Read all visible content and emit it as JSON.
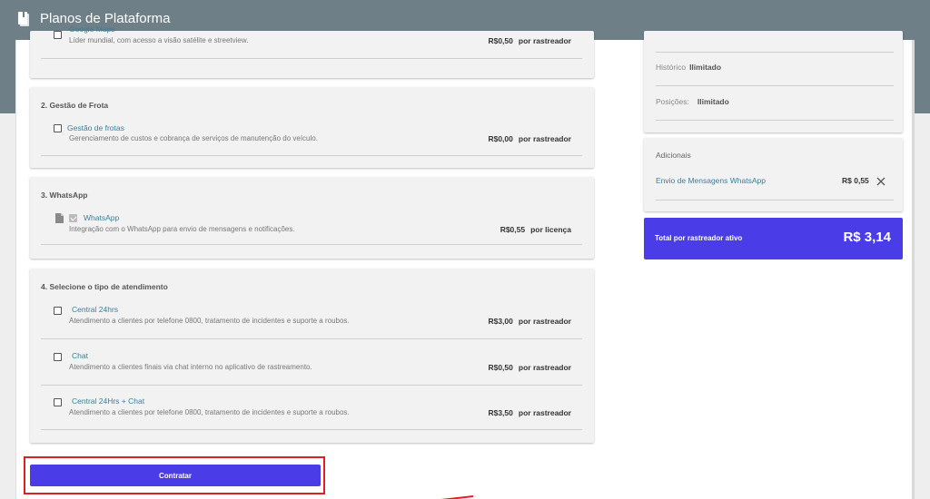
{
  "app": {
    "title": "Planos de Plataforma"
  },
  "sections": {
    "maps": {
      "partial_label": "Google Maps",
      "desc": "Líder mundial, com acesso a visão satélite e streetview.",
      "price": "R$0,50",
      "unit": "por rastreador"
    },
    "fleet": {
      "heading": "2. Gestão de Frota",
      "item": {
        "label": "Gestão de frotas",
        "desc": "Gerenciamento de custos e cobrança de serviços de manutenção do veículo.",
        "price": "R$0,00",
        "unit": "por rastreador"
      }
    },
    "whatsapp": {
      "heading": "3. WhatsApp",
      "item": {
        "label": "WhatsApp",
        "desc": "Integração com o WhatsApp para envio de mensagens e notificações.",
        "price": "R$0,55",
        "unit": "por licença",
        "checked": true
      }
    },
    "service": {
      "heading": "4. Selecione o tipo de atendimento",
      "items": [
        {
          "label": "Central 24hrs",
          "desc": "Atendimento a clientes por telefone 0800, tratamento de incidentes e suporte a roubos.",
          "price": "R$3,00",
          "unit": "por rastreador"
        },
        {
          "label": "Chat",
          "desc": "Atendimento a clientes finais via chat interno no aplicativo de rastreamento.",
          "price": "R$0,50",
          "unit": "por rastreador"
        },
        {
          "label": "Central 24Hrs + Chat",
          "desc": "Atendimento a clientes por telefone 0800, tratamento de incidentes e suporte a roubos.",
          "price": "R$3,50",
          "unit": "por rastreador"
        }
      ]
    }
  },
  "summary": {
    "historico_label": "Histórico",
    "historico_value": "Ilimitado",
    "posicoes_label": "Posições:",
    "posicoes_value": "Ilimitado",
    "adicionais_heading": "Adicionais",
    "addon_label": "Envio de Mensagens WhatsApp",
    "addon_price": "R$ 0,55",
    "total_label": "Total por rastreador ativo",
    "total_value": "R$ 3,14"
  },
  "actions": {
    "contract_label": "Contratar"
  },
  "colors": {
    "primary": "#4a3de8",
    "topbar": "#6e7f88",
    "highlight": "#e02020",
    "link": "#3a7f9c"
  }
}
